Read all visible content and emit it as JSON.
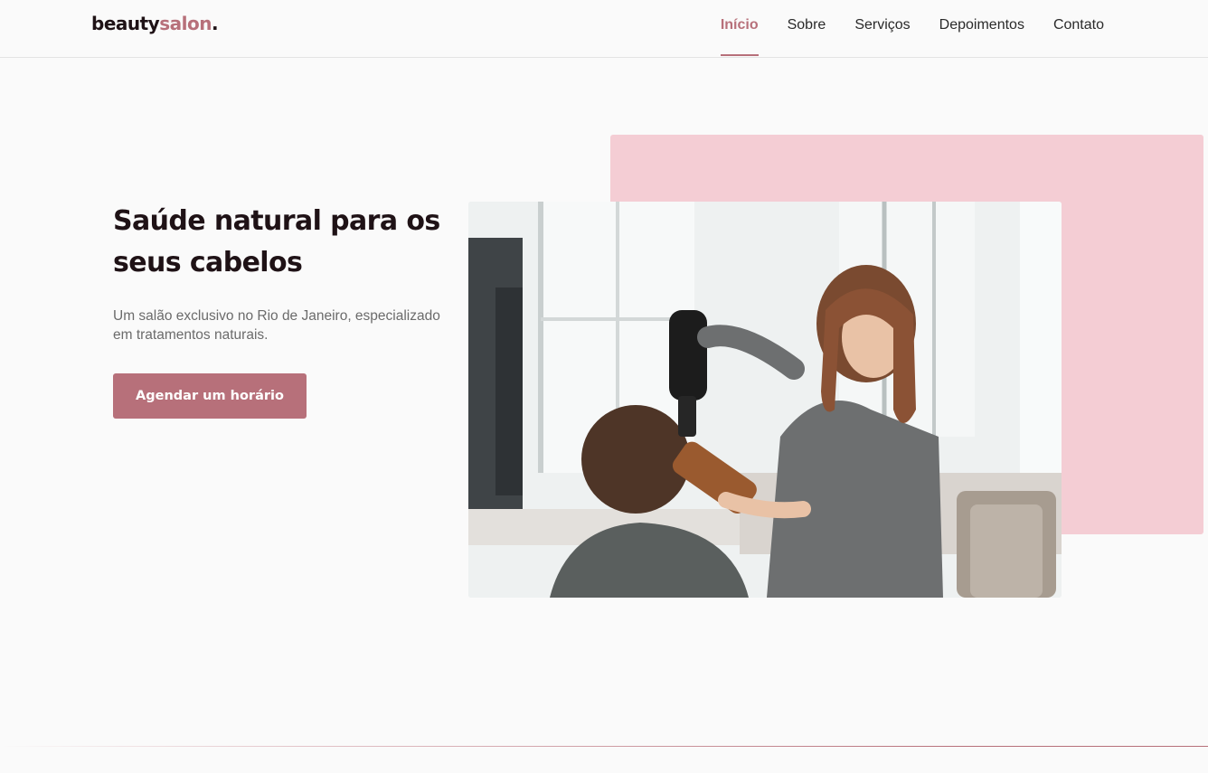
{
  "header": {
    "logo": {
      "main": "beauty",
      "accent": "salon",
      "dot": "."
    },
    "nav": [
      {
        "label": "Início",
        "active": true
      },
      {
        "label": "Sobre",
        "active": false
      },
      {
        "label": "Serviços",
        "active": false
      },
      {
        "label": "Depoimentos",
        "active": false
      },
      {
        "label": "Contato",
        "active": false
      }
    ]
  },
  "hero": {
    "title": "Saúde natural para os seus cabelos",
    "subtitle": "Um salão exclusivo no Rio de Janeiro, especializado em tratamentos naturais.",
    "cta_label": "Agendar um horário",
    "image": "hairdresser-drying-client-hair-photo"
  },
  "colors": {
    "accent": "#b7707a",
    "pink_block": "#f4cdd4",
    "text_dark": "#1f1216",
    "text_muted": "#6b6b6b",
    "background": "#fafafa"
  }
}
